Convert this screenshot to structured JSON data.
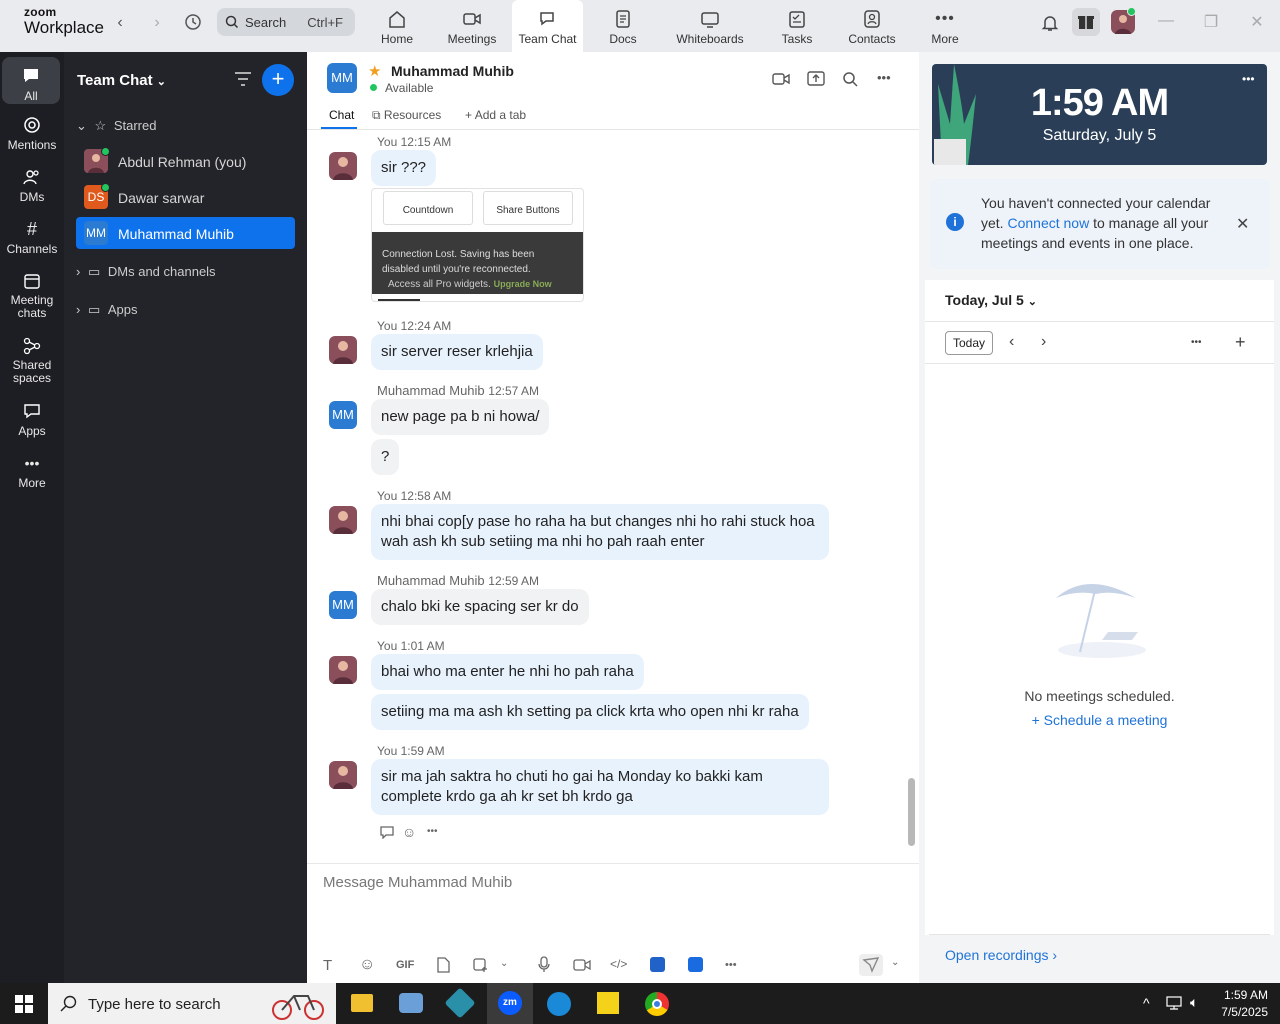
{
  "titlebar": {
    "logo_top": "zoom",
    "logo_bottom": "Workplace",
    "search_label": "Search",
    "search_shortcut": "Ctrl+F",
    "tabs": [
      {
        "label": "Home",
        "icon": "home-icon"
      },
      {
        "label": "Meetings",
        "icon": "video-icon"
      },
      {
        "label": "Team Chat",
        "icon": "chat-icon"
      },
      {
        "label": "Docs",
        "icon": "docs-icon"
      },
      {
        "label": "Whiteboards",
        "icon": "whiteboard-icon"
      },
      {
        "label": "Tasks",
        "icon": "tasks-icon"
      },
      {
        "label": "Contacts",
        "icon": "contacts-icon"
      },
      {
        "label": "More",
        "icon": "more-icon"
      }
    ],
    "active_tab": "Team Chat"
  },
  "rail": {
    "items": [
      {
        "label": "All",
        "icon": "chat-bubble-icon"
      },
      {
        "label": "Mentions",
        "icon": "at-icon"
      },
      {
        "label": "DMs",
        "icon": "people-icon"
      },
      {
        "label": "Channels",
        "icon": "hash-icon"
      },
      {
        "label": "Meeting chats",
        "icon": "calendar-icon"
      },
      {
        "label": "Shared spaces",
        "icon": "share-icon"
      },
      {
        "label": "Apps",
        "icon": "apps-icon"
      },
      {
        "label": "More",
        "icon": "more-icon"
      }
    ]
  },
  "side": {
    "title": "Team Chat",
    "starred_label": "Starred",
    "contacts": [
      {
        "name": "Abdul Rehman (you)",
        "initials": ""
      },
      {
        "name": "Dawar sarwar",
        "initials": "DS"
      },
      {
        "name": "Muhammad Muhib",
        "initials": "MM"
      }
    ],
    "dms_label": "DMs and channels",
    "apps_label": "Apps"
  },
  "chat": {
    "name": "Muhammad Muhib",
    "initials": "MM",
    "status": "Available",
    "tabs": {
      "chat": "Chat",
      "resources": "Resources",
      "add": "Add a tab"
    },
    "embed": {
      "countdown": "Countdown",
      "share_buttons": "Share Buttons",
      "lost_line1": "Connection Lost. Saving has been",
      "lost_line2": "disabled until you're reconnected.",
      "pro": "Access all Pro widgets.",
      "upgrade": "Upgrade Now"
    },
    "messages": [
      {
        "sender": "You",
        "time": "12:15 AM",
        "text": "sir ???"
      },
      {
        "sender": "You",
        "time": "12:24 AM",
        "text": "sir server reser krlehjia"
      },
      {
        "sender": "Muhammad Muhib",
        "time": "12:57 AM",
        "text": "new page pa b ni howa/"
      },
      {
        "sender": "Muhammad Muhib",
        "time": "",
        "text": "?"
      },
      {
        "sender": "You",
        "time": "12:58 AM",
        "text": "nhi bhai cop[y pase ho raha ha but changes nhi ho rahi stuck hoa wah ash kh sub setiing ma nhi ho pah raah enter"
      },
      {
        "sender": "Muhammad Muhib",
        "time": "12:59 AM",
        "text": "chalo bki ke spacing ser kr do"
      },
      {
        "sender": "You",
        "time": "1:01 AM",
        "text": "bhai who ma enter he nhi ho pah raha"
      },
      {
        "sender": "You",
        "time": "",
        "text": "setiing ma ma ash kh setting pa click krta who open nhi kr raha"
      },
      {
        "sender": "You",
        "time": "1:59 AM",
        "text": "sir ma jah saktra ho chuti ho gai ha Monday ko bakki kam complete krdo ga ah kr set bh krdo ga"
      }
    ],
    "composer_placeholder": "Message Muhammad Muhib",
    "gif_label": "GIF"
  },
  "right": {
    "time": "1:59 AM",
    "date": "Saturday, July 5",
    "notice_pre": "You haven't connected your calendar yet.",
    "notice_link": "Connect now",
    "notice_post": "to manage all your meetings and events in one place.",
    "day_label": "Today, Jul 5",
    "today_button": "Today",
    "no_meetings": "No meetings scheduled.",
    "schedule_link": "Schedule a meeting",
    "recordings_link": "Open recordings"
  },
  "taskbar": {
    "search_placeholder": "Type here to search",
    "time": "1:59 AM",
    "date": "7/5/2025"
  },
  "colors": {
    "accent": "#0e72ed",
    "rail_bg": "#1d1e23",
    "side_bg": "#232429",
    "bubble_self": "#e8f2fd"
  }
}
